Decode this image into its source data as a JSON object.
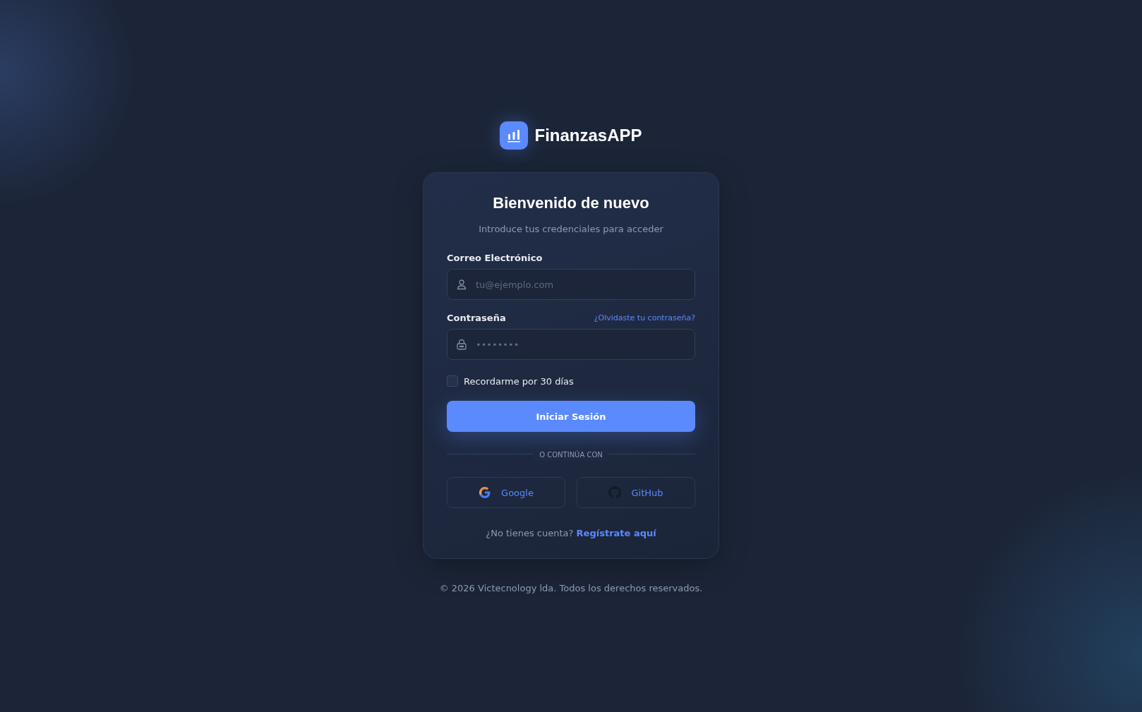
{
  "brand": {
    "name": "FinanzasAPP"
  },
  "card": {
    "title": "Bienvenido de nuevo",
    "subtitle": "Introduce tus credenciales para acceder"
  },
  "fields": [
    {
      "kind": "email",
      "label": "Correo Electrónico",
      "placeholder": "tu@ejemplo.com"
    },
    {
      "kind": "password",
      "label": "Contraseña",
      "link": "¿Olvidaste tu contraseña?",
      "placeholder": "••••••••"
    }
  ],
  "remember": {
    "label": "Recordarme por 30 días",
    "checked": false
  },
  "submit": "Iniciar Sesión",
  "divider": "O CONTINÚA CON",
  "social": [
    {
      "kind": "google",
      "label": "Google"
    },
    {
      "kind": "github",
      "label": "GitHub"
    }
  ],
  "signup": {
    "text": "¿No tienes cuenta?",
    "link": "Regístrate aquí"
  },
  "footer": "© 2026 Victecnology lda. Todos los derechos reservados."
}
